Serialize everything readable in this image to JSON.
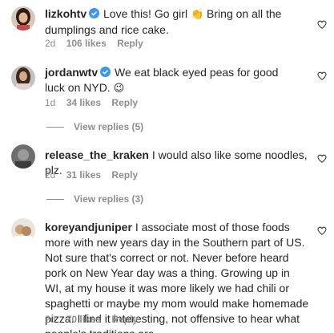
{
  "comments": [
    {
      "username": "lizkohtv",
      "verified": true,
      "text_before": "Love this! Go girl",
      "emoji_1": "👏",
      "text_after": "Bring on all the dumplings and rice cake.",
      "time": "2d",
      "likes": "106 likes",
      "reply": "Reply"
    },
    {
      "username": "jordanwtv",
      "verified": true,
      "text": "We eat black eyed peas for good luck on NYD.",
      "emoji_1": "😉",
      "time": "1d",
      "likes": "34 likes",
      "reply": "Reply",
      "view_replies": "View replies (5)"
    },
    {
      "username": "release_the_kraken",
      "verified": false,
      "text": "I would also like some noodles, plz.",
      "time": "2d",
      "likes": "31 likes",
      "reply": "Reply",
      "view_replies": "View replies (3)"
    },
    {
      "username": "koreyandjuniper",
      "verified": false,
      "text": "I associate most of those foods more with new years day in the Southern part of US. Not sure that's correct or not. Never before heard pork on New Year day was a thing. Growing up in WI, at my house it was more likely we had chili or spaghetti or maybe my mom would make homemade pizza. I find it interesting, not offensive to hear what people's traditions are.",
      "time": "2d",
      "likes": "70 likes",
      "reply": "Reply"
    }
  ],
  "colors": {
    "text": "#262626",
    "secondary": "#8e8e8e",
    "verified": "#3897f0"
  },
  "icons": {
    "verified": "verified-badge-icon",
    "like": "heart-outline-icon"
  }
}
